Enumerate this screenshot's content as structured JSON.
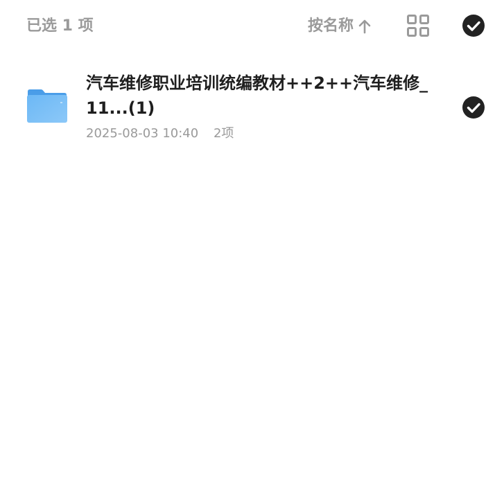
{
  "header": {
    "selected_count": "已选 1 项",
    "sort_label": "按名称",
    "sort_direction_icon": "arrow-up-icon",
    "view_toggle_icon": "grid-view-icon",
    "select_all_icon": "check-circle-icon"
  },
  "files": [
    {
      "name": "汽车维修职业培训统编教材++2++汽车维修_11...(1)",
      "date": "2025-08-03 10:40",
      "count": "2项",
      "icon": "folder-icon",
      "selected": true
    }
  ],
  "colors": {
    "muted_text": "#9a9a9a",
    "primary_text": "#1f1f1f",
    "check_fill": "#222222",
    "folder_blue": "#5aaaf0"
  }
}
